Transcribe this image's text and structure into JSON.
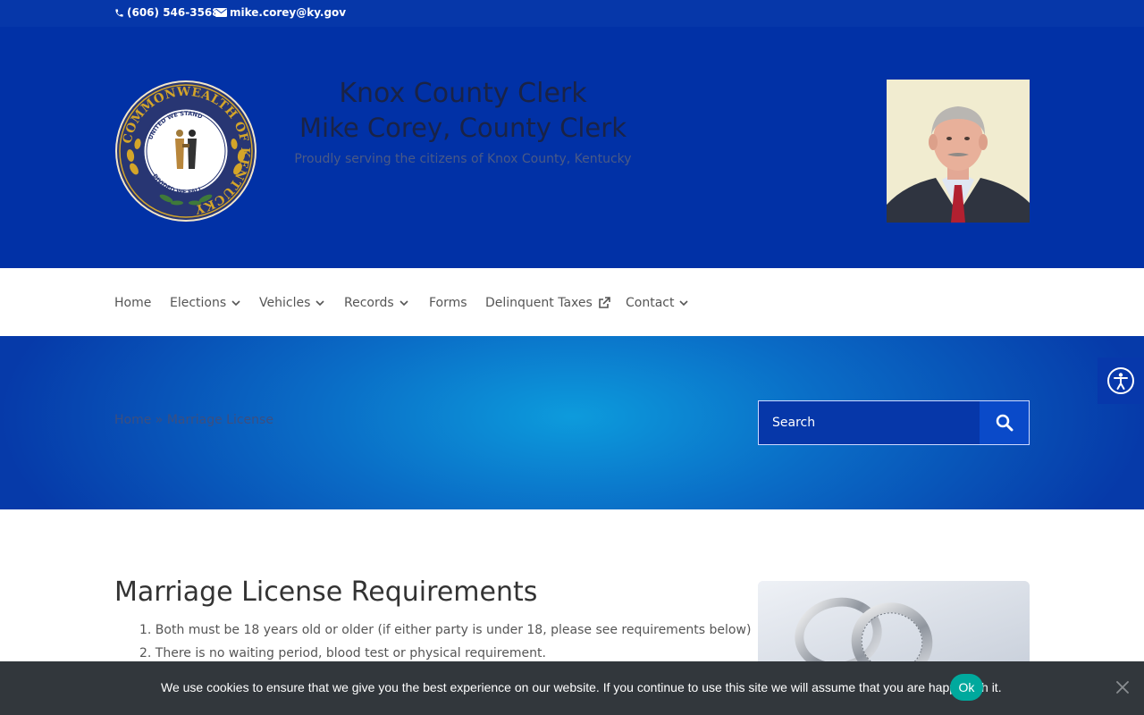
{
  "topbar": {
    "phone": "(606) 546-3568",
    "email": "mike.corey@ky.gov",
    "phone_icon": "phone-icon",
    "email_icon": "envelope-icon"
  },
  "header": {
    "title": "Knox County Clerk",
    "subtitle": "Mike Corey, County Clerk",
    "tagline": "Proudly serving the citizens of Knox County, Kentucky",
    "seal": {
      "outer_text": "COMMONWEALTH OF KENTUCKY",
      "motto_top": "UNITED WE STAND",
      "motto_bottom": "DIVIDED WE FALL"
    }
  },
  "nav": {
    "items": [
      {
        "label": "Home",
        "icon": ""
      },
      {
        "label": "Elections",
        "icon": "chevron-down-icon"
      },
      {
        "label": "Vehicles",
        "icon": "chevron-down-icon"
      },
      {
        "label": "Records",
        "icon": "chevron-down-icon"
      },
      {
        "label": "Forms",
        "icon": ""
      },
      {
        "label": "Delinquent Taxes",
        "icon": "external-link-icon"
      },
      {
        "label": "Contact",
        "icon": "chevron-down-icon"
      }
    ]
  },
  "hero": {
    "breadcrumb": {
      "home": "Home",
      "separator": "»",
      "current": "Marriage License"
    },
    "search": {
      "placeholder": "Search",
      "icon": "search-icon"
    }
  },
  "accessibility": {
    "icon": "accessibility-icon"
  },
  "content": {
    "title": "Marriage License Requirements",
    "requirements": [
      "1. Both must be 18 years old or older (if either party is under 18, please see requirements below)",
      "2. There is no waiting period, blood test or physical requirement."
    ]
  },
  "cookie": {
    "text": "We use cookies to ensure that we give you the best experience on our website. If you continue to use this site we will assume that you are happy with it.",
    "ok_label": "Ok",
    "close_icon": "close-icon"
  },
  "colors": {
    "topbar": "#0637a9",
    "header": "#0131a6",
    "cookie_bg": "#32373c",
    "cookie_ok": "#00a99d",
    "seal_ring": "#2a3a7a",
    "seal_gold": "#d4a529"
  }
}
